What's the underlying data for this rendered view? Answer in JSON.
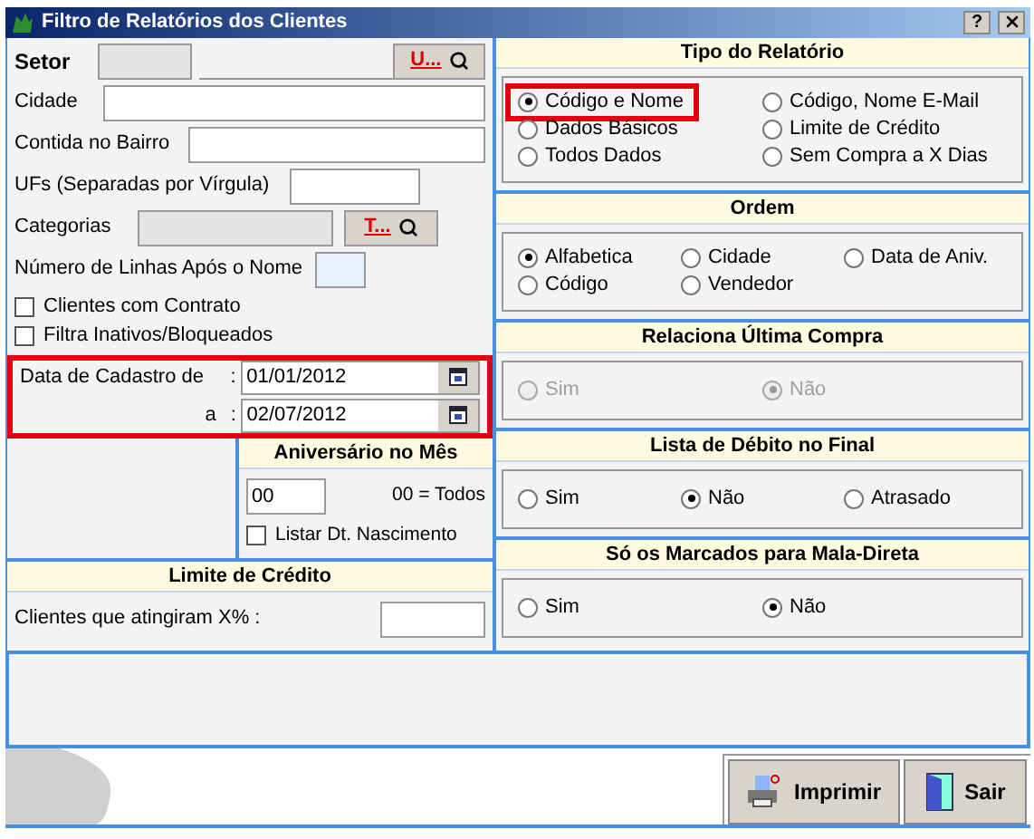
{
  "window": {
    "title": "Filtro de Relatórios dos Clientes",
    "help": "?"
  },
  "filters": {
    "setor": {
      "label": "Setor",
      "button": "U..."
    },
    "cidade": {
      "label": "Cidade"
    },
    "bairro": {
      "label": "Contida no Bairro"
    },
    "ufs": {
      "label": "UFs (Separadas por Vírgula)"
    },
    "categorias": {
      "label": "Categorias",
      "button": "T..."
    },
    "linhas": {
      "label": "Número de Linhas Após o Nome"
    },
    "checks": [
      {
        "label": "Clientes com Contrato",
        "checked": false
      },
      {
        "label": "Filtra Inativos/Bloqueados",
        "checked": false
      }
    ],
    "cadastro": {
      "highlighted": true,
      "label_from": "Data de Cadastro de",
      "label_to": "a",
      "sep_from": ":",
      "sep_to": ":",
      "from": "01/01/2012",
      "to": "02/07/2012"
    }
  },
  "aniversario": {
    "title": "Aniversário no Mês",
    "value": "00",
    "hint": "00 = Todos",
    "check": {
      "label": "Listar Dt. Nascimento",
      "checked": false
    }
  },
  "limite": {
    "title": "Limite de Crédito",
    "label": "Clientes que atingiram X% :"
  },
  "groups": [
    {
      "title": "Tipo do Relatório",
      "kind": "two_col",
      "options": [
        {
          "label": "Código e Nome",
          "selected": true,
          "disabled": false,
          "highlighted": true
        },
        {
          "label": "Código, Nome E-Mail",
          "selected": false,
          "disabled": false,
          "highlighted": false
        },
        {
          "label": "Dados Básicos",
          "selected": false,
          "disabled": false,
          "highlighted": false
        },
        {
          "label": "Limite de Crédito",
          "selected": false,
          "disabled": false,
          "highlighted": false
        },
        {
          "label": "Todos Dados",
          "selected": false,
          "disabled": false,
          "highlighted": false
        },
        {
          "label": "Sem Compra a X Dias",
          "selected": false,
          "disabled": false,
          "highlighted": false
        }
      ]
    },
    {
      "title": "Ordem",
      "kind": "three_col",
      "options": [
        {
          "label": "Alfabetica",
          "selected": true,
          "disabled": false,
          "highlighted": false
        },
        {
          "label": "Cidade",
          "selected": false,
          "disabled": false,
          "highlighted": false
        },
        {
          "label": "Data de Aniv.",
          "selected": false,
          "disabled": false,
          "highlighted": false
        },
        {
          "label": "Código",
          "selected": false,
          "disabled": false,
          "highlighted": false
        },
        {
          "label": "Vendedor",
          "selected": false,
          "disabled": false,
          "highlighted": false
        }
      ]
    },
    {
      "title": "Relaciona Última Compra",
      "kind": "two_col",
      "options": [
        {
          "label": "Sim",
          "selected": false,
          "disabled": true,
          "highlighted": false
        },
        {
          "label": "Não",
          "selected": true,
          "disabled": true,
          "highlighted": false
        }
      ]
    },
    {
      "title": "Lista de Débito no Final",
      "kind": "three_col",
      "options": [
        {
          "label": "Sim",
          "selected": false,
          "disabled": false,
          "highlighted": false
        },
        {
          "label": "Não",
          "selected": true,
          "disabled": false,
          "highlighted": false
        },
        {
          "label": "Atrasado",
          "selected": false,
          "disabled": false,
          "highlighted": false
        }
      ]
    },
    {
      "title": "Só os Marcados para Mala-Direta",
      "kind": "two_col",
      "options": [
        {
          "label": "Sim",
          "selected": false,
          "disabled": false,
          "highlighted": false
        },
        {
          "label": "Não",
          "selected": true,
          "disabled": false,
          "highlighted": false
        }
      ]
    }
  ],
  "buttons": [
    {
      "kind": "print",
      "label": "Imprimir"
    },
    {
      "kind": "exit",
      "label": "Sair"
    }
  ]
}
